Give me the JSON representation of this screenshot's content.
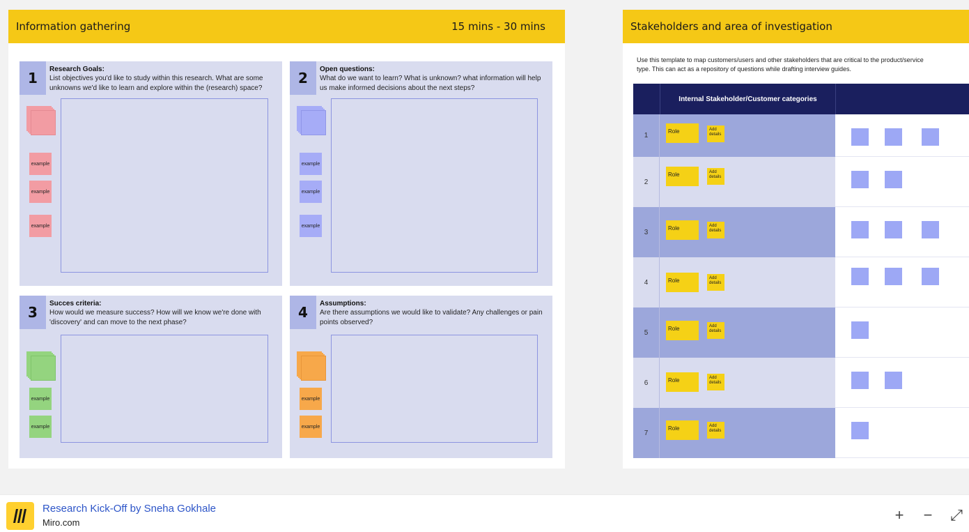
{
  "frame1": {
    "title": "Information gathering",
    "time": "15 mins - 30 mins",
    "panels": [
      {
        "number": "1",
        "title": "Research Goals:",
        "desc": "List objectives you'd like to study within this research. What are some unknowns we'd like to learn and explore within the (research) space?",
        "sticky_label": "example"
      },
      {
        "number": "2",
        "title": "Open questions:",
        "desc": "What do we want to learn? What is unknown? what information will help us make informed decisions about the next steps?",
        "sticky_label": "example"
      },
      {
        "number": "3",
        "title": "Succes criteria:",
        "desc": "How would we measure success? How will we know we're done with 'discovery' and can move to the next phase?",
        "sticky_label": "example"
      },
      {
        "number": "4",
        "title": "Assumptions:",
        "desc": "Are there assumptions we would like to validate? Any challenges or pain points observed?",
        "sticky_label": "example"
      }
    ],
    "colors": {
      "header": "#f5c816",
      "goals": "#f29ca3",
      "questions": "#a6acf7",
      "criteria": "#94d47f",
      "assumptions": "#f7a84a"
    }
  },
  "frame2": {
    "title": "Stakeholders and area of investigation",
    "intro_line1": "Use this template to map customers/users and other stakeholders that are critical to the product/service",
    "intro_line2": "type. This can act as a repository of questions while drafting interview guides.",
    "table_header": "Internal Stakeholder/Customer categories",
    "rows": [
      {
        "num": "1",
        "role": "Role",
        "add": "Add details"
      },
      {
        "num": "2",
        "role": "Role",
        "add": "Add details"
      },
      {
        "num": "3",
        "role": "Role",
        "add": "Add details"
      },
      {
        "num": "4",
        "role": "Role",
        "add": "Add details"
      },
      {
        "num": "5",
        "role": "Role",
        "add": "Add details"
      },
      {
        "num": "6",
        "role": "Role",
        "add": "Add details"
      },
      {
        "num": "7",
        "role": "Role",
        "add": "Add details"
      }
    ]
  },
  "bottombar": {
    "board_name": "Research Kick-Off by Sneha Gokhale",
    "site": "Miro.com",
    "zoom_in": "+",
    "zoom_out": "−",
    "fullscreen": "⤢"
  }
}
